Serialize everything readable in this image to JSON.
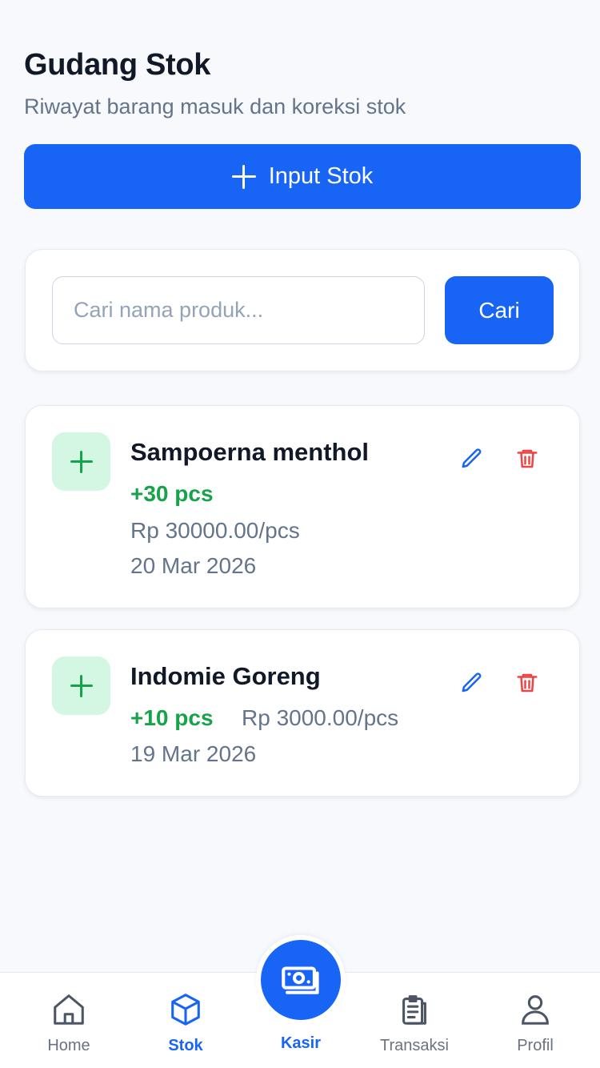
{
  "header": {
    "title": "Gudang Stok",
    "subtitle": "Riwayat barang masuk dan koreksi stok"
  },
  "actions": {
    "input_stok_label": "Input Stok"
  },
  "search": {
    "placeholder": "Cari nama produk...",
    "value": "",
    "button_label": "Cari"
  },
  "items": [
    {
      "name": "Sampoerna menthol",
      "qty": "+30 pcs",
      "price": "Rp 30000.00/pcs",
      "date": "20 Mar 2026"
    },
    {
      "name": "Indomie Goreng",
      "qty": "+10 pcs",
      "price": "Rp 3000.00/pcs",
      "date": "19 Mar 2026"
    }
  ],
  "nav": {
    "items": [
      {
        "label": "Home",
        "icon": "home-icon",
        "active": false
      },
      {
        "label": "Stok",
        "icon": "box-icon",
        "active": true
      },
      {
        "label": "Kasir",
        "icon": "cash-icon",
        "active": false
      },
      {
        "label": "Transaksi",
        "icon": "clipboard-icon",
        "active": false
      },
      {
        "label": "Profil",
        "icon": "user-icon",
        "active": false
      }
    ]
  },
  "colors": {
    "primary": "#1865f5",
    "success": "#16a34a",
    "success_bg": "#d4f7e4",
    "danger": "#ef4444",
    "muted": "#64748b",
    "background": "#f7f9fc"
  }
}
